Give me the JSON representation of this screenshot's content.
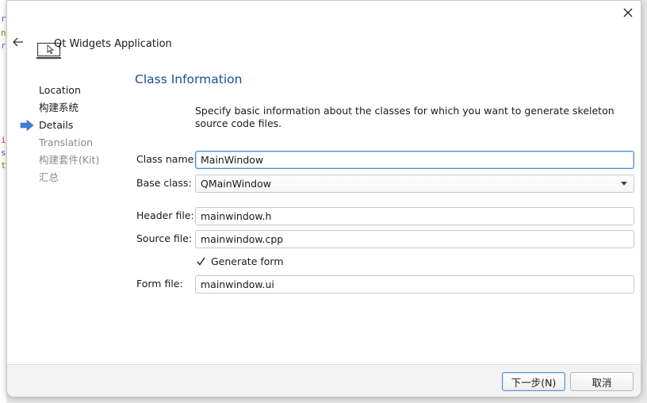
{
  "wizard": {
    "title": "Qt Widgets Application",
    "page_title": "Class Information",
    "description": "Specify basic information about the classes for which you want to generate skeleton source code files."
  },
  "steps": [
    {
      "label": "Location",
      "state": "done"
    },
    {
      "label": "构建系统",
      "state": "done"
    },
    {
      "label": "Details",
      "state": "current"
    },
    {
      "label": "Translation",
      "state": "pending"
    },
    {
      "label": "构建套件(Kit)",
      "state": "pending"
    },
    {
      "label": "汇总",
      "state": "pending"
    }
  ],
  "form": {
    "class_name_label": "Class name:",
    "class_name_value": "MainWindow",
    "base_class_label": "Base class:",
    "base_class_value": "QMainWindow",
    "header_file_label": "Header file:",
    "header_file_value": "mainwindow.h",
    "source_file_label": "Source file:",
    "source_file_value": "mainwindow.cpp",
    "generate_form_label": "Generate form",
    "generate_form_checked": true,
    "form_file_label": "Form file:",
    "form_file_value": "mainwindow.ui"
  },
  "buttons": {
    "next": "下一步(N)",
    "cancel": "取消"
  },
  "icons": {
    "close": "close-icon",
    "back": "back-arrow-icon",
    "wizard": "monitor-cursor-icon",
    "current_step": "current-step-arrow-icon"
  },
  "colors": {
    "page_title": "#1c4d9b",
    "focus_border": "#4a90d9",
    "step_arrow": "#3d7fd6",
    "disabled_text": "#8a8a8a"
  }
}
